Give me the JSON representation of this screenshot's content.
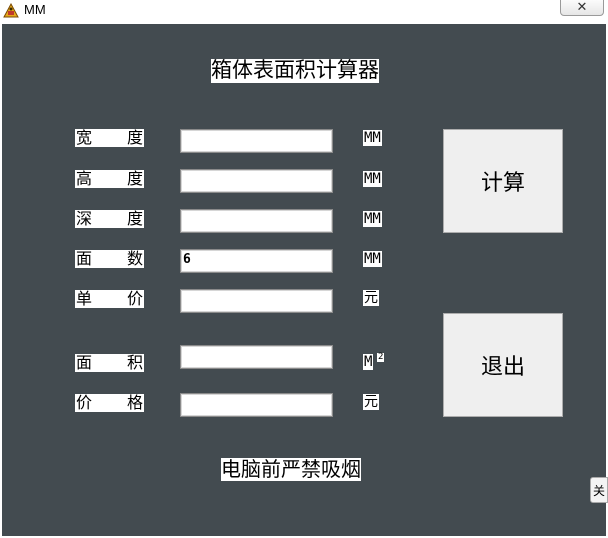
{
  "window": {
    "title": "MM",
    "icon": "app-icon"
  },
  "form": {
    "heading": "箱体表面积计算器",
    "footer": "电脑前严禁吸烟",
    "fields": [
      {
        "label_a": "宽",
        "label_b": "度",
        "value": "",
        "unit": "MM"
      },
      {
        "label_a": "高",
        "label_b": "度",
        "value": "",
        "unit": "MM"
      },
      {
        "label_a": "深",
        "label_b": "度",
        "value": "",
        "unit": "MM"
      },
      {
        "label_a": "面",
        "label_b": "数",
        "value": "6",
        "unit": "MM"
      },
      {
        "label_a": "单",
        "label_b": "价",
        "value": "",
        "unit": "元"
      },
      {
        "label_a": "面",
        "label_b": "积",
        "value": "",
        "unit": "M",
        "unit_sup": "2"
      },
      {
        "label_a": "价",
        "label_b": "格",
        "value": "",
        "unit": "元"
      }
    ],
    "calculate_label": "计算",
    "exit_label": "退出"
  },
  "side_tab": {
    "label": "关"
  },
  "colors": {
    "client_background": "#434b50",
    "button_face": "#efefef"
  }
}
